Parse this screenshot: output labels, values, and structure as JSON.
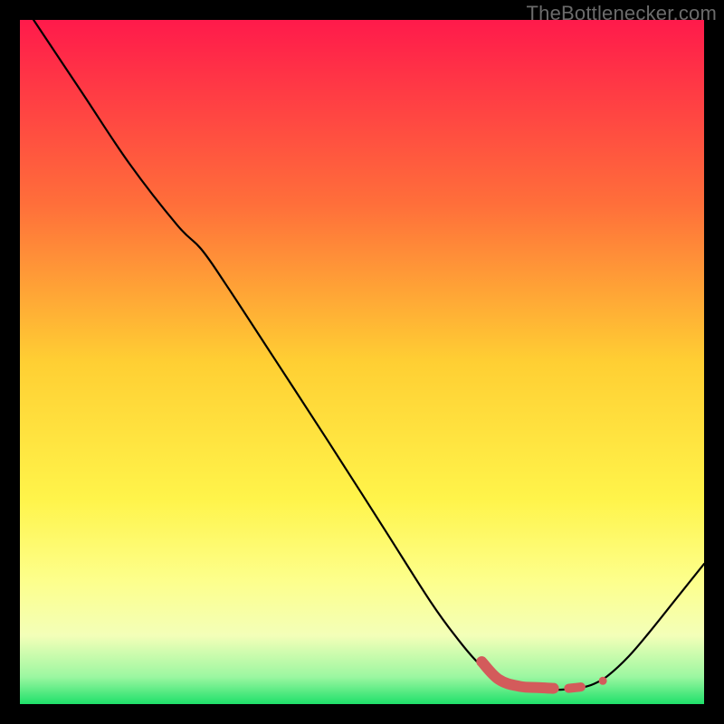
{
  "watermark": "TheBottlenecker.com",
  "chart_data": {
    "type": "line",
    "title": "",
    "xlabel": "",
    "ylabel": "",
    "xlim": [
      0,
      100
    ],
    "ylim": [
      0,
      100
    ],
    "gradient_stops": [
      {
        "pct": 0,
        "color": "#ff1a4b"
      },
      {
        "pct": 27,
        "color": "#ff6f3a"
      },
      {
        "pct": 50,
        "color": "#ffcf33"
      },
      {
        "pct": 70,
        "color": "#fff44a"
      },
      {
        "pct": 82,
        "color": "#fdff8c"
      },
      {
        "pct": 90,
        "color": "#f3ffb8"
      },
      {
        "pct": 96,
        "color": "#9cf7a1"
      },
      {
        "pct": 100,
        "color": "#1fe06a"
      }
    ],
    "series": [
      {
        "name": "bottleneck-curve",
        "color": "#000000",
        "width": 2.2,
        "points": [
          {
            "x": 2.0,
            "y": 100.0
          },
          {
            "x": 9.0,
            "y": 89.5
          },
          {
            "x": 16.0,
            "y": 79.0
          },
          {
            "x": 23.0,
            "y": 70.0
          },
          {
            "x": 26.5,
            "y": 66.5
          },
          {
            "x": 30.0,
            "y": 61.5
          },
          {
            "x": 37.0,
            "y": 50.8
          },
          {
            "x": 45.0,
            "y": 38.5
          },
          {
            "x": 53.0,
            "y": 26.0
          },
          {
            "x": 60.0,
            "y": 15.0
          },
          {
            "x": 64.0,
            "y": 9.5
          },
          {
            "x": 67.0,
            "y": 6.0
          },
          {
            "x": 70.0,
            "y": 3.6
          },
          {
            "x": 73.0,
            "y": 2.6
          },
          {
            "x": 76.0,
            "y": 2.2
          },
          {
            "x": 79.0,
            "y": 2.1
          },
          {
            "x": 82.0,
            "y": 2.4
          },
          {
            "x": 84.0,
            "y": 3.0
          },
          {
            "x": 86.0,
            "y": 4.2
          },
          {
            "x": 89.0,
            "y": 7.0
          },
          {
            "x": 92.0,
            "y": 10.5
          },
          {
            "x": 96.0,
            "y": 15.5
          },
          {
            "x": 100.0,
            "y": 20.5
          }
        ]
      },
      {
        "name": "recommended-range-main",
        "type": "capsule",
        "color": "#d35b5b",
        "points": [
          {
            "x": 67.5,
            "y": 6.2
          },
          {
            "x": 70.0,
            "y": 3.6
          },
          {
            "x": 73.0,
            "y": 2.6
          },
          {
            "x": 76.0,
            "y": 2.4
          },
          {
            "x": 78.0,
            "y": 2.3
          }
        ],
        "width": 12
      },
      {
        "name": "recommended-dash-1",
        "type": "capsule",
        "color": "#d35b5b",
        "points": [
          {
            "x": 80.2,
            "y": 2.3
          },
          {
            "x": 82.0,
            "y": 2.5
          }
        ],
        "width": 10
      },
      {
        "name": "recommended-dot",
        "type": "dot",
        "color": "#d35b5b",
        "cx": 85.2,
        "cy": 3.4,
        "r": 4.5
      }
    ]
  }
}
